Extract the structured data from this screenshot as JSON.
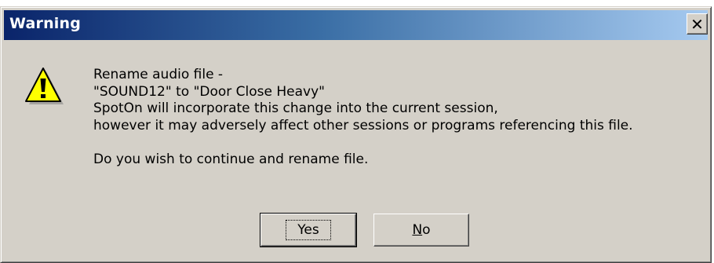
{
  "window": {
    "title": "Warning",
    "close_glyph": "✕"
  },
  "icon": {
    "name": "warning-icon",
    "color": "#ffff00"
  },
  "message": {
    "lines": [
      "Rename audio file -",
      "\"SOUND12\" to \"Door Close Heavy\"",
      "SpotOn will incorporate this change into the current session,",
      "however it may adversely affect other sessions or programs referencing this file."
    ],
    "question": "Do you wish to continue and rename file."
  },
  "buttons": {
    "yes_label": "Yes",
    "no_label": "No"
  },
  "colors": {
    "title_gradient_start": "#0a246a",
    "title_gradient_end": "#a6caf0",
    "face": "#d4d0c8"
  }
}
